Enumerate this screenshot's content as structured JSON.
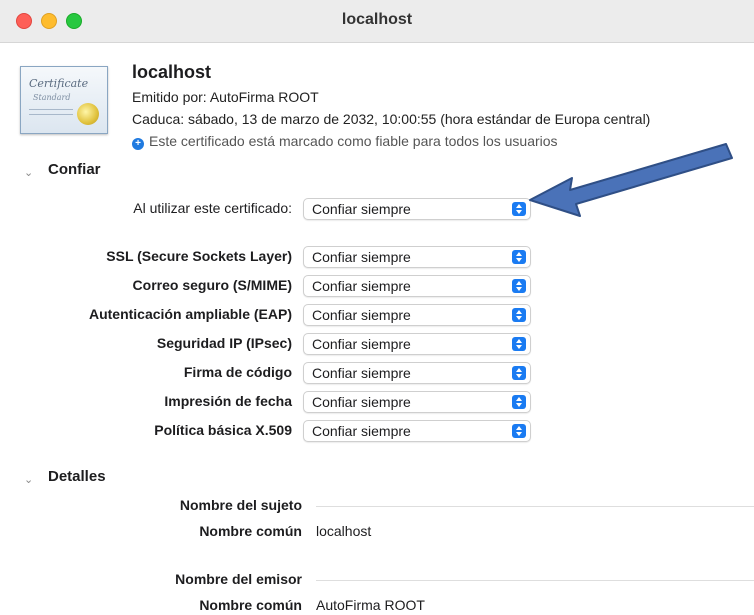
{
  "window": {
    "title": "localhost"
  },
  "certificate": {
    "name": "localhost",
    "issued_by": "Emitido por: AutoFirma ROOT",
    "expires": "Caduca: sábado, 13 de marzo de 2032, 10:00:55 (hora estándar de Europa central)",
    "trust_status": "Este certificado está marcado como fiable para todos los usuarios",
    "icon_text_1": "Certificate",
    "icon_text_2": "Standard"
  },
  "trust": {
    "title": "Confiar",
    "when_using_label": "Al utilizar este certificado:",
    "when_using_value": "Confiar siempre",
    "items": [
      {
        "label": "SSL (Secure Sockets Layer)",
        "value": "Confiar siempre"
      },
      {
        "label": "Correo seguro (S/MIME)",
        "value": "Confiar siempre"
      },
      {
        "label": "Autenticación ampliable (EAP)",
        "value": "Confiar siempre"
      },
      {
        "label": "Seguridad IP (IPsec)",
        "value": "Confiar siempre"
      },
      {
        "label": "Firma de código",
        "value": "Confiar siempre"
      },
      {
        "label": "Impresión de fecha",
        "value": "Confiar siempre"
      },
      {
        "label": "Política básica X.509",
        "value": "Confiar siempre"
      }
    ]
  },
  "details": {
    "title": "Detalles",
    "subject_heading": "Nombre del sujeto",
    "subject_common_name_label": "Nombre común",
    "subject_common_name_value": "localhost",
    "issuer_heading": "Nombre del emisor",
    "issuer_common_name_label": "Nombre común",
    "issuer_common_name_value": "AutoFirma ROOT"
  },
  "icons": {
    "chevron": "chevron-down-icon",
    "info": "plus-circle-icon",
    "stepper": "popup-stepper-icon",
    "annotation": "arrow-annotation"
  },
  "colors": {
    "accent": "#1a7bf2",
    "arrow_fill": "#4a72b8",
    "arrow_stroke": "#2f4f86"
  }
}
